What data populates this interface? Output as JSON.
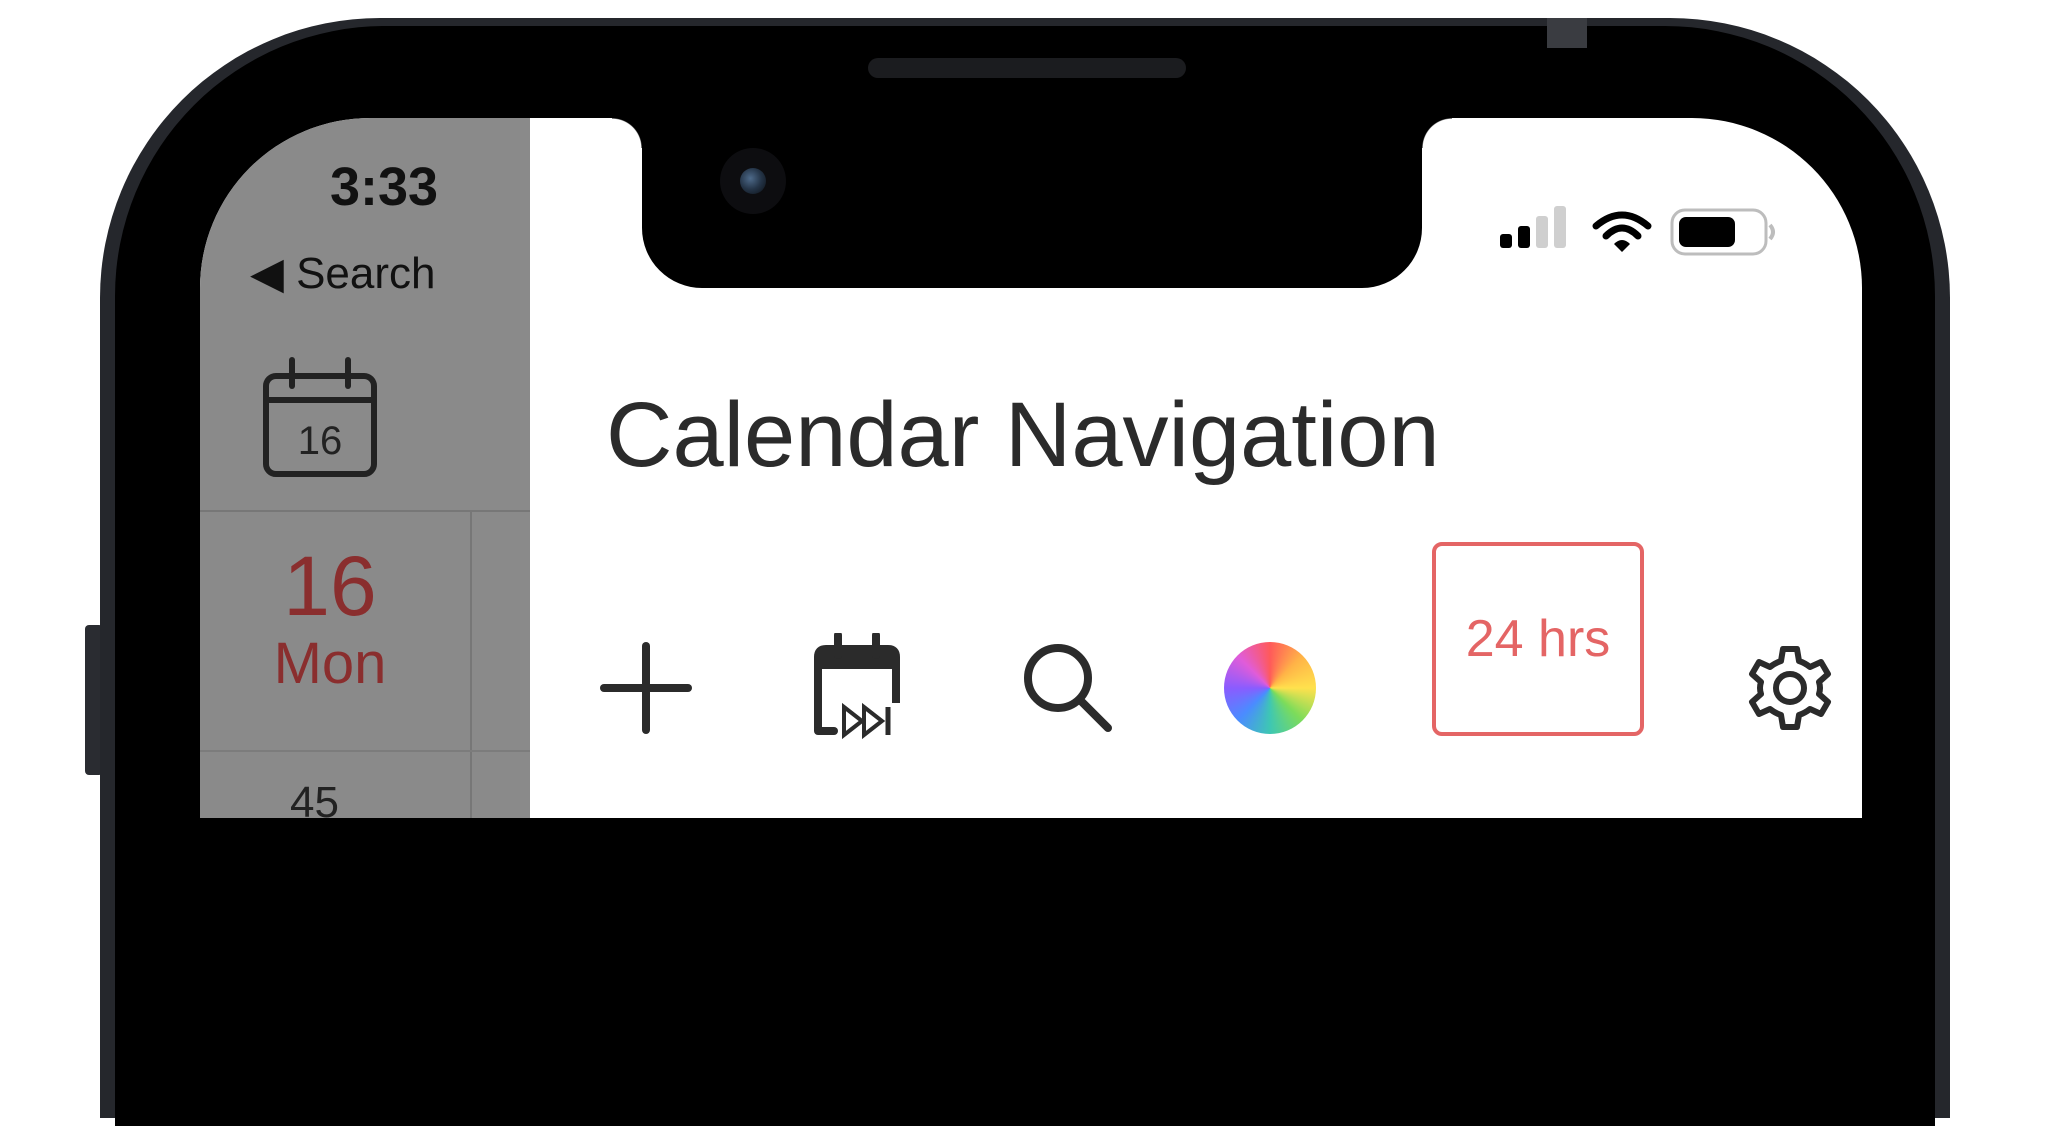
{
  "status_bar": {
    "time": "3:33",
    "back_label": "◀ Search"
  },
  "side_panel": {
    "calendar_icon_day": "16",
    "date_number": "16",
    "date_weekday": "Mon",
    "partial_row_text": "45"
  },
  "header": {
    "title": "Calendar Navigation"
  },
  "toolbar": {
    "add_icon": "plus-icon",
    "jump_icon": "calendar-fast-forward-icon",
    "search_icon": "search-icon",
    "color_icon": "color-wheel-icon",
    "hours_label": "24 hrs",
    "settings_icon": "gear-icon"
  },
  "colors": {
    "accent": "#e46565",
    "date_red": "#8a2e2e",
    "panel_gray": "#8a8a8a",
    "text_dark": "#2b2b2b"
  }
}
